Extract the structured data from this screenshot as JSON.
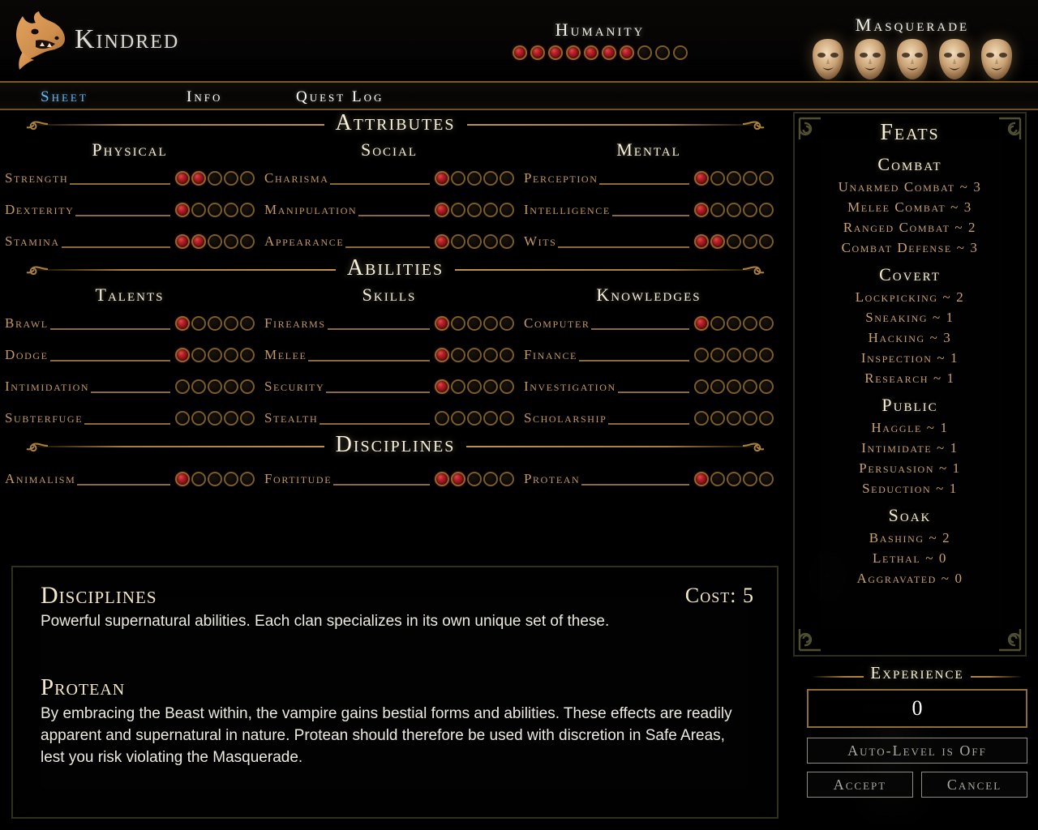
{
  "header": {
    "logo_icon": "wolf-head-icon",
    "app_title": "Kindred",
    "humanity": {
      "label": "Humanity",
      "value": 7,
      "max": 10
    },
    "masquerade": {
      "label": "Masquerade",
      "value": 5,
      "max": 5,
      "icon": "mask-icon"
    }
  },
  "tabs": [
    {
      "label": "Sheet",
      "active": true
    },
    {
      "label": "Info",
      "active": false
    },
    {
      "label": "Quest Log",
      "active": false
    }
  ],
  "sections": [
    {
      "title": "Attributes",
      "columns": [
        "Physical",
        "Social",
        "Mental"
      ],
      "rows": [
        [
          {
            "name": "Strength",
            "value": 2,
            "max": 5
          },
          {
            "name": "Charisma",
            "value": 1,
            "max": 5
          },
          {
            "name": "Perception",
            "value": 1,
            "max": 5
          }
        ],
        [
          {
            "name": "Dexterity",
            "value": 1,
            "max": 5
          },
          {
            "name": "Manipulation",
            "value": 1,
            "max": 5
          },
          {
            "name": "Intelligence",
            "value": 1,
            "max": 5
          }
        ],
        [
          {
            "name": "Stamina",
            "value": 2,
            "max": 5
          },
          {
            "name": "Appearance",
            "value": 1,
            "max": 5
          },
          {
            "name": "Wits",
            "value": 2,
            "max": 5
          }
        ]
      ]
    },
    {
      "title": "Abilities",
      "columns": [
        "Talents",
        "Skills",
        "Knowledges"
      ],
      "rows": [
        [
          {
            "name": "Brawl",
            "value": 1,
            "max": 5
          },
          {
            "name": "Firearms",
            "value": 1,
            "max": 5
          },
          {
            "name": "Computer",
            "value": 1,
            "max": 5
          }
        ],
        [
          {
            "name": "Dodge",
            "value": 1,
            "max": 5
          },
          {
            "name": "Melee",
            "value": 1,
            "max": 5
          },
          {
            "name": "Finance",
            "value": 0,
            "max": 5
          }
        ],
        [
          {
            "name": "Intimidation",
            "value": 0,
            "max": 5
          },
          {
            "name": "Security",
            "value": 1,
            "max": 5
          },
          {
            "name": "Investigation",
            "value": 0,
            "max": 5
          }
        ],
        [
          {
            "name": "Subterfuge",
            "value": 0,
            "max": 5
          },
          {
            "name": "Stealth",
            "value": 0,
            "max": 5
          },
          {
            "name": "Scholarship",
            "value": 0,
            "max": 5
          }
        ]
      ]
    },
    {
      "title": "Disciplines",
      "columns": [],
      "rows": [
        [
          {
            "name": "Animalism",
            "value": 1,
            "max": 5
          },
          {
            "name": "Fortitude",
            "value": 2,
            "max": 5
          },
          {
            "name": "Protean",
            "value": 1,
            "max": 5
          }
        ]
      ]
    }
  ],
  "description": {
    "category_title": "Disciplines",
    "cost_label": "Cost:",
    "cost_value": "5",
    "category_text": "Powerful supernatural abilities. Each clan specializes in its own unique set of these.",
    "item_title": "Protean",
    "item_text": "By embracing the Beast within, the vampire gains bestial forms and abilities. These effects are readily apparent and supernatural in nature. Protean should therefore be used with discretion in Safe Areas, lest you risk violating the Masquerade."
  },
  "feats": {
    "title": "Feats",
    "groups": [
      {
        "title": "Combat",
        "entries": [
          {
            "name": "Unarmed Combat",
            "sep": "~",
            "value": 3
          },
          {
            "name": "Melee Combat",
            "sep": "~",
            "value": 3
          },
          {
            "name": "Ranged Combat",
            "sep": "~",
            "value": 2
          },
          {
            "name": "Combat Defense",
            "sep": "~",
            "value": 3
          }
        ]
      },
      {
        "title": "Covert",
        "entries": [
          {
            "name": "Lockpicking",
            "sep": "~",
            "value": 2
          },
          {
            "name": "Sneaking",
            "sep": "~",
            "value": 1
          },
          {
            "name": "Hacking",
            "sep": "~",
            "value": 3
          },
          {
            "name": "Inspection",
            "sep": "~",
            "value": 1
          },
          {
            "name": "Research",
            "sep": "~",
            "value": 1
          }
        ]
      },
      {
        "title": "Public",
        "entries": [
          {
            "name": "Haggle",
            "sep": "~",
            "value": 1
          },
          {
            "name": "Intimidate",
            "sep": "~",
            "value": 1
          },
          {
            "name": "Persuasion",
            "sep": "~",
            "value": 1
          },
          {
            "name": "Seduction",
            "sep": "~",
            "value": 1
          }
        ]
      },
      {
        "title": "Soak",
        "entries": [
          {
            "name": "Bashing",
            "sep": "~",
            "value": 2
          },
          {
            "name": "Lethal",
            "sep": "~",
            "value": 0
          },
          {
            "name": "Aggravated",
            "sep": "~",
            "value": 0
          }
        ]
      }
    ]
  },
  "experience": {
    "label": "Experience",
    "value": "0",
    "autolevel_label": "Auto-Level is Off",
    "accept_label": "Accept",
    "cancel_label": "Cancel"
  },
  "colors": {
    "gold": "#c39a4d",
    "label_tan": "#c49a62",
    "cream": "#f4e9c4",
    "active_tab": "#6cb9ec",
    "pip_filled": "#b51f24",
    "pip_ring": "#7b5c27"
  }
}
